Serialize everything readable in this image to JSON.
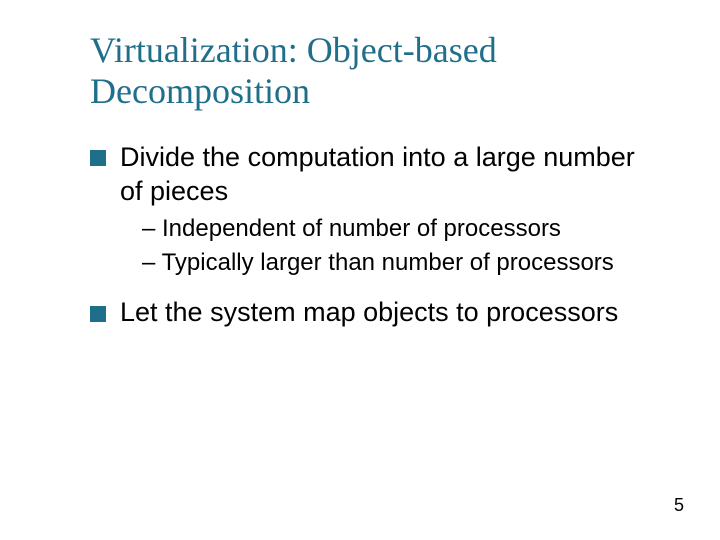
{
  "title": "Virtualization: Object-based Decomposition",
  "bullets": [
    {
      "text": "Divide the computation into a large number of pieces",
      "subs": [
        "– Independent of number of processors",
        "– Typically larger than number of processors"
      ]
    },
    {
      "text": "Let the system map objects  to processors",
      "subs": []
    }
  ],
  "page_number": "5"
}
